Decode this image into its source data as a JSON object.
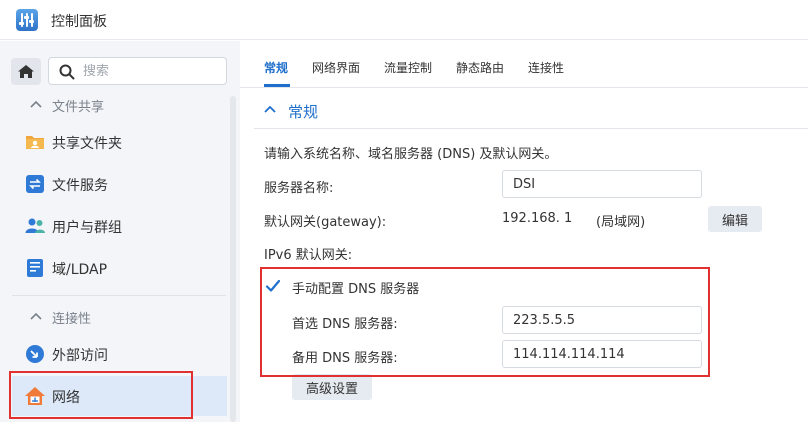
{
  "window": {
    "title": "控制面板"
  },
  "sidebar": {
    "search_placeholder": "搜索",
    "sections": [
      {
        "label": "文件共享"
      },
      {
        "label": "连接性"
      }
    ],
    "items": [
      {
        "label": "共享文件夹",
        "icon": "shared-folder-icon"
      },
      {
        "label": "文件服务",
        "icon": "file-services-icon"
      },
      {
        "label": "用户与群组",
        "icon": "users-groups-icon"
      },
      {
        "label": "域/LDAP",
        "icon": "domain-ldap-icon"
      },
      {
        "label": "外部访问",
        "icon": "external-access-icon"
      },
      {
        "label": "网络",
        "icon": "network-house-icon"
      }
    ],
    "active_item": "网络"
  },
  "main": {
    "tabs": [
      {
        "label": "常规"
      },
      {
        "label": "网络界面"
      },
      {
        "label": "流量控制"
      },
      {
        "label": "静态路由"
      },
      {
        "label": "连接性"
      }
    ],
    "active_tab": "常规",
    "group_title": "常规",
    "description": "请输入系统名称、域名服务器 (DNS) 及默认网关。",
    "server_name_label": "服务器名称:",
    "server_name_value": "DSI",
    "gateway_label": "默认网关(gateway):",
    "gateway_ip": "192.168.    1",
    "gateway_interface": "(局域网)",
    "edit_button": "编辑",
    "ipv6_gateway_label": "IPv6 默认网关:",
    "manual_dns_label": "手动配置 DNS 服务器",
    "manual_dns_checked": true,
    "preferred_dns_label": "首选 DNS 服务器:",
    "preferred_dns_value": "223.5.5.5",
    "alternate_dns_label": "备用 DNS 服务器:",
    "alternate_dns_value": "114.114.114.114",
    "advanced_button": "高级设置"
  },
  "colors": {
    "accent": "#1f6fcc",
    "highlight": "#e03030",
    "sidebar_bg": "#f3f5f8",
    "active_item_bg": "#dde9f8"
  }
}
